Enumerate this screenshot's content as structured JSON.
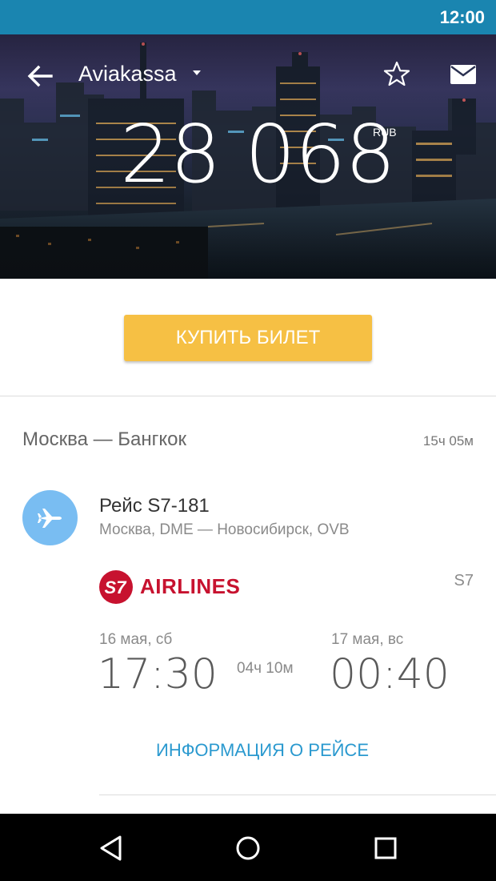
{
  "status_bar": {
    "time": "12:00"
  },
  "toolbar": {
    "title": "Aviakassa",
    "back_icon": "arrow-left-icon",
    "dropdown_icon": "caret-down-icon",
    "favorite_icon": "star-outline-icon",
    "mail_icon": "mail-icon"
  },
  "hero": {
    "price": "28 068",
    "currency": "RUB",
    "background": "night-city-skyline-photo"
  },
  "buy_button": {
    "label": "КУПИТЬ БИЛЕТ",
    "color": "#f6c044"
  },
  "trip": {
    "route": "Москва — Бангкок",
    "total_duration": "15ч 05м"
  },
  "segment": {
    "icon": "airplane-icon",
    "flight_number": "Рейс S7-181",
    "route": "Москва, DME — Новосибирск, OVB",
    "airline_name": "AIRLINES",
    "airline_logo_text": "S7",
    "airline_code": "S7",
    "departure": {
      "date": "16 мая, сб",
      "time": "17:30"
    },
    "duration": "04ч 10м",
    "arrival": {
      "date": "17 мая, вс",
      "time": "00:40"
    },
    "info_link": "ИНФОРМАЦИЯ О РЕЙСЕ"
  },
  "nav_bar": {
    "back_icon": "triangle-back-icon",
    "home_icon": "circle-home-icon",
    "recents_icon": "square-recents-icon"
  },
  "colors": {
    "status_bar": "#1a85b0",
    "accent_link": "#2a99cf",
    "plane_circle": "#79bdf2",
    "airline_red": "#c7122f"
  }
}
